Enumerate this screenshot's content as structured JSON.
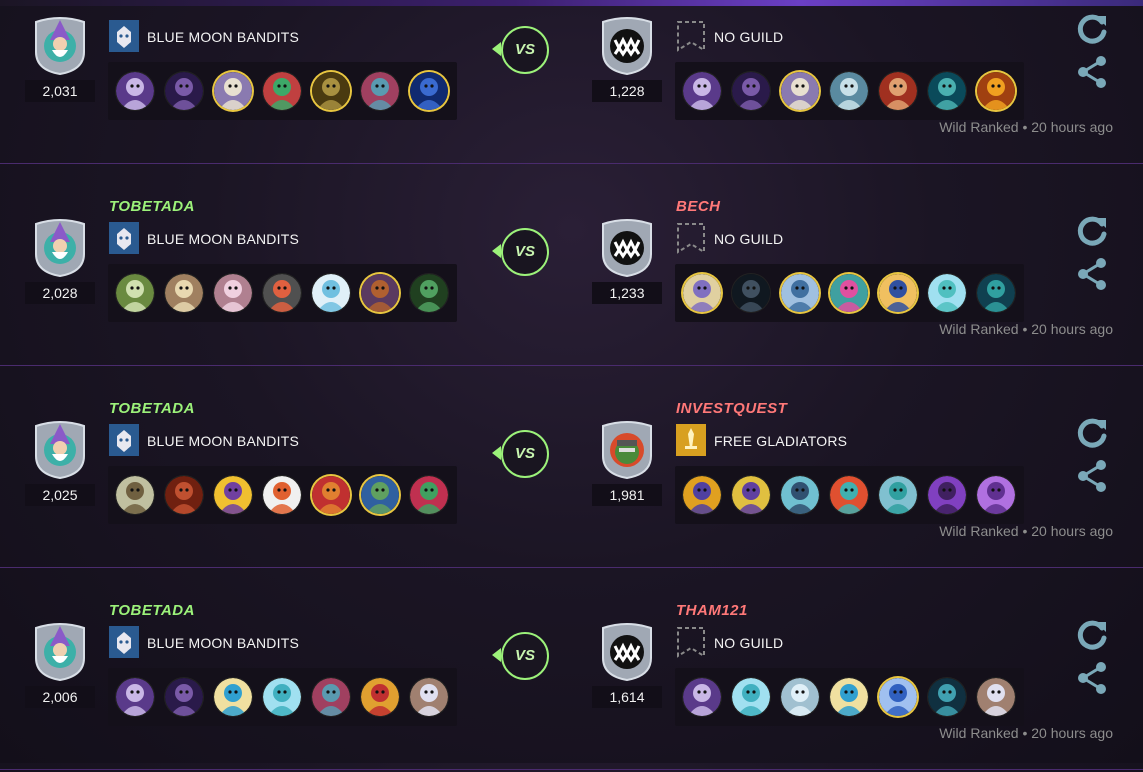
{
  "colors": {
    "accent_green": "#9cf27a",
    "accent_red": "#ff7878",
    "divider": "#4a2b6e",
    "action_icon": "#7aa8b8"
  },
  "battles": [
    {
      "left": {
        "name": "",
        "rating": "2,031",
        "guild": "BLUE MOON BANDITS",
        "shield": "wizard-shield-icon",
        "team": [
          "c1",
          "c2",
          "c3g",
          "c4",
          "c5g",
          "c6",
          "c7g"
        ]
      },
      "right": {
        "name": "",
        "rating": "1,228",
        "guild": "NO GUILD",
        "shield": "monster-mouth-shield-icon",
        "team": [
          "c1",
          "c2",
          "c3g",
          "c8",
          "c9",
          "c10",
          "c11g"
        ]
      },
      "vs": "VS",
      "meta": "Wild Ranked • 20 hours ago"
    },
    {
      "left": {
        "name": "TOBETADA",
        "rating": "2,028",
        "guild": "BLUE MOON BANDITS",
        "shield": "wizard-shield-icon",
        "team": [
          "c12",
          "c13",
          "c14",
          "c15",
          "c16",
          "c17g",
          "c18"
        ]
      },
      "right": {
        "name": "BECH",
        "rating": "1,233",
        "guild": "NO GUILD",
        "shield": "monster-mouth-shield-icon",
        "team": [
          "c19g",
          "c20",
          "c21g",
          "c22g",
          "c23g",
          "c24",
          "c25"
        ]
      },
      "vs": "VS",
      "meta": "Wild Ranked • 20 hours ago"
    },
    {
      "left": {
        "name": "TOBETADA",
        "rating": "2,025",
        "guild": "BLUE MOON BANDITS",
        "shield": "wizard-shield-icon",
        "team": [
          "c26",
          "c27",
          "c28",
          "c29",
          "c30g",
          "c31g",
          "c32"
        ]
      },
      "right": {
        "name": "INVESTQUEST",
        "rating": "1,981",
        "guild": "FREE GLADIATORS",
        "shield": "orc-shield-icon",
        "team": [
          "c33",
          "c34",
          "c35",
          "c36",
          "c37",
          "c38",
          "c39"
        ]
      },
      "vs": "VS",
      "meta": "Wild Ranked • 20 hours ago"
    },
    {
      "left": {
        "name": "TOBETADA",
        "rating": "2,006",
        "guild": "BLUE MOON BANDITS",
        "shield": "wizard-shield-icon",
        "team": [
          "c1",
          "c2",
          "c40",
          "c41",
          "c6",
          "c42",
          "c43"
        ]
      },
      "right": {
        "name": "THAM121",
        "rating": "1,614",
        "guild": "NO GUILD",
        "shield": "monster-mouth-shield-icon",
        "team": [
          "c1",
          "c41",
          "c44",
          "c40",
          "c45g",
          "c46",
          "c43"
        ]
      },
      "vs": "VS",
      "meta": "Wild Ranked • 20 hours ago"
    }
  ]
}
